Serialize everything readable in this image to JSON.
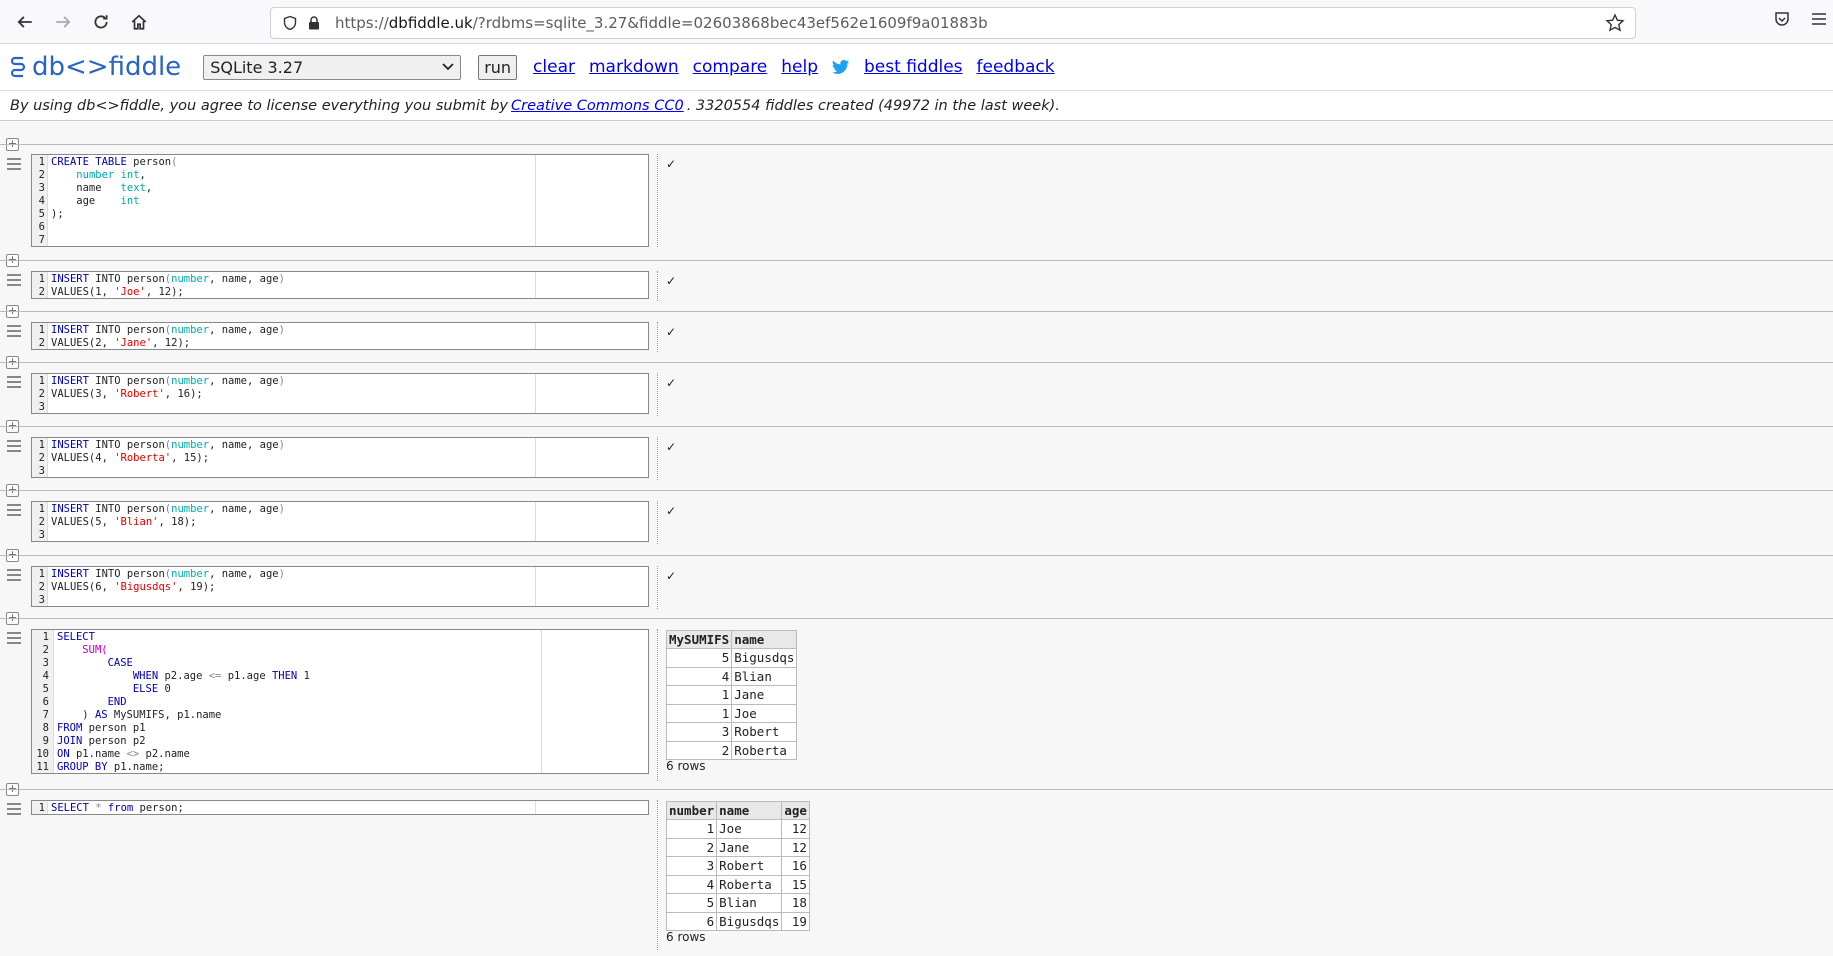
{
  "browser": {
    "url_prefix": "https://",
    "url_host": "dbfiddle.uk",
    "url_path": "/?rdbms=sqlite_3.27&fiddle=02603868bec43ef562e1609f9a01883b"
  },
  "header": {
    "logo": "db<>fiddle",
    "rdbms_selected": "SQLite 3.27",
    "run": "run",
    "links": [
      "clear",
      "markdown",
      "compare",
      "help",
      "best fiddles",
      "feedback"
    ]
  },
  "notice": {
    "before": "By using db<>fiddle, you agree to license everything you submit by",
    "link": "Creative Commons CC0",
    "after": ". 3320554 fiddles created (49972 in the last week)."
  },
  "check": "✓",
  "results": {
    "sumifs": {
      "columns": [
        "MySUMIFS",
        "name"
      ],
      "rows": [
        [
          "5",
          "Bigusdqs"
        ],
        [
          "4",
          "Blian"
        ],
        [
          "1",
          "Jane"
        ],
        [
          "1",
          "Joe"
        ],
        [
          "3",
          "Robert"
        ],
        [
          "2",
          "Roberta"
        ]
      ],
      "count": "6 rows"
    },
    "person": {
      "columns": [
        "number",
        "name",
        "age"
      ],
      "rows": [
        [
          "1",
          "Joe",
          "12"
        ],
        [
          "2",
          "Jane",
          "12"
        ],
        [
          "3",
          "Robert",
          "16"
        ],
        [
          "4",
          "Roberta",
          "15"
        ],
        [
          "5",
          "Blian",
          "18"
        ],
        [
          "6",
          "Bigusdqs",
          "19"
        ]
      ],
      "count": "6 rows"
    }
  }
}
